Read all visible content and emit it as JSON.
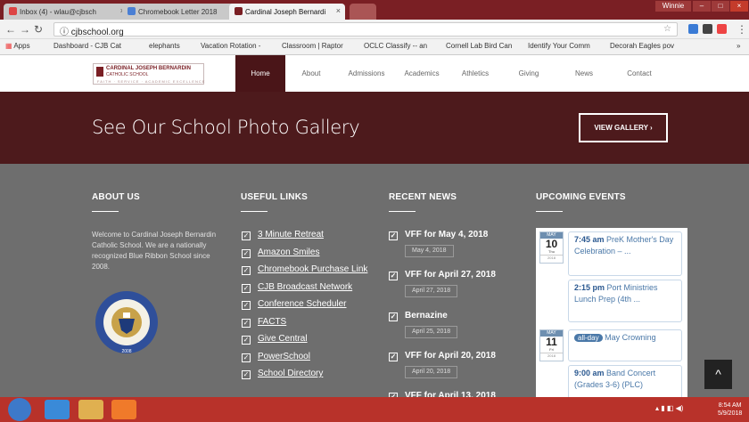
{
  "browser": {
    "tabs": [
      {
        "label": "Inbox (4) - wlau@cjbsch",
        "close": "×"
      },
      {
        "label": "Chromebook Letter 2018",
        "close": "×"
      },
      {
        "label": "Cardinal Joseph Bernardi",
        "close": "×"
      }
    ],
    "user": "Winnie",
    "url": "cjbschool.org",
    "bookmarks": [
      "Apps",
      "Dashboard - CJB Cat",
      "elephants",
      "Vacation Rotation -",
      "Classroom | Raptor",
      "OCLC Classify -- an",
      "Cornell Lab Bird Can",
      "Identify Your Comm",
      "Decorah Eagles pov"
    ],
    "bookmarks_more": "»"
  },
  "site": {
    "logo": {
      "line1": "CARDINAL JOSEPH BERNARDIN",
      "line2": "CATHOLIC SCHOOL",
      "tagline": "FAITH · SERVICE · ACADEMIC EXCELLENCE"
    },
    "nav": [
      "Home",
      "About",
      "Admissions",
      "Academics",
      "Athletics",
      "Giving",
      "News",
      "Contact"
    ],
    "hero": {
      "title": "See Our School Photo Gallery",
      "button": "VIEW GALLERY ›"
    },
    "about": {
      "heading": "ABOUT US",
      "text": "Welcome to Cardinal Joseph Bernardin Catholic School. We are a nationally recognized Blue Ribbon School since 2008.",
      "seal_year": "2008"
    },
    "useful_links": {
      "heading": "USEFUL LINKS",
      "items": [
        "3 Minute Retreat",
        "Amazon Smiles",
        "Chromebook Purchase Link",
        "CJB Broadcast Network",
        "Conference Scheduler",
        "FACTS",
        "Give Central",
        "PowerSchool",
        "School Directory"
      ]
    },
    "recent_news": {
      "heading": "RECENT NEWS",
      "items": [
        {
          "title": "VFF for May 4, 2018",
          "date": "May 4, 2018"
        },
        {
          "title": "VFF for April 27, 2018",
          "date": "April 27, 2018"
        },
        {
          "title": "Bernazine",
          "date": "April 25, 2018"
        },
        {
          "title": "VFF for April 20, 2018",
          "date": "April 20, 2018"
        },
        {
          "title": "VFF for April 13, 2018",
          "date": ""
        }
      ]
    },
    "upcoming_events": {
      "heading": "UPCOMING EVENTS",
      "days": [
        {
          "month": "MAY",
          "day": "10",
          "weekday": "Thu",
          "year": "2018"
        },
        {
          "month": "MAY",
          "day": "11",
          "weekday": "Fri",
          "year": "2018"
        }
      ],
      "events": [
        {
          "time": "7:45 am",
          "title": "PreK Mother's Day Celebration – ..."
        },
        {
          "time": "2:15 pm",
          "title": "Port Ministries Lunch Prep (4th ..."
        },
        {
          "time": "all-day",
          "title": "May Crowning"
        },
        {
          "time": "9:00 am",
          "title": "Band Concert (Grades 3-6) (PLC)"
        }
      ]
    },
    "back_to_top": "^"
  },
  "taskbar": {
    "time": "8:54 AM",
    "date": "5/9/2018"
  },
  "colors": {
    "maroon": "#4d1a1c",
    "footer": "#6e6e6e",
    "taskbar": "#b8322a",
    "accent_blue": "#4a78a8"
  }
}
